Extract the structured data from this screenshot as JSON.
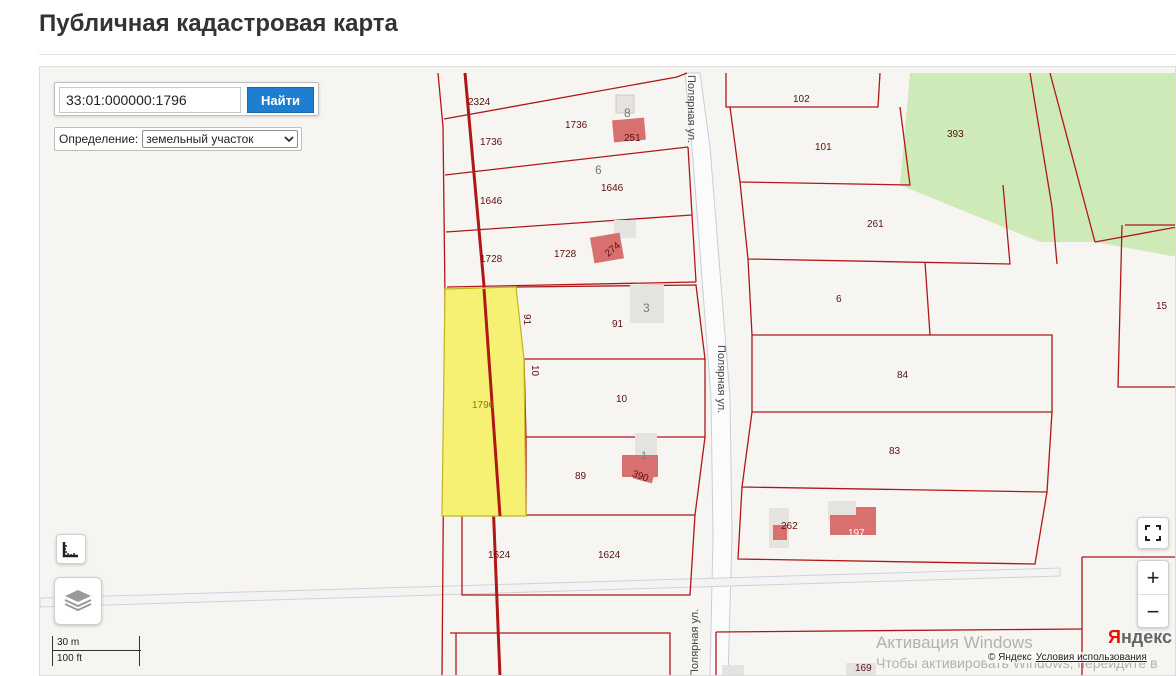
{
  "page": {
    "title": "Публичная кадастровая карта"
  },
  "search": {
    "value": "33:01:000000:1796",
    "button_label": "Найти"
  },
  "definition": {
    "label": "Определение:",
    "selected": "земельный участок"
  },
  "map": {
    "streets": [
      "Полярная ул.",
      "Полярная ул.",
      "Полярная ул."
    ],
    "parcels": [
      "2324",
      "1736",
      "1736",
      "251",
      "8",
      "1646",
      "1646",
      "6",
      "1728",
      "1728",
      "274",
      "91",
      "91",
      "3",
      "1796",
      "10",
      "10",
      "89",
      "390",
      "1",
      "1624",
      "1624",
      "102",
      "101",
      "393",
      "261",
      "6",
      "84",
      "83",
      "262",
      "197",
      "15",
      "169"
    ],
    "selected_parcel": "1796"
  },
  "scale": {
    "metric": "30 m",
    "imperial": "100 ft"
  },
  "yandex": {
    "logo_y": "Я",
    "logo_rest": "ндекс",
    "copyright": "© Яндекс",
    "terms": "Условия использования"
  },
  "watermark": {
    "title": "Активация Windows",
    "text": "Чтобы активировать Windows, перейдите в"
  },
  "controls": {
    "zoom_in": "+",
    "zoom_out": "−"
  },
  "colors": {
    "parcel_border": "#b01818",
    "selected_fill": "#f6f173",
    "forest": "#cdeab8",
    "building": "#d97070",
    "search_button": "#1e7fd0"
  }
}
